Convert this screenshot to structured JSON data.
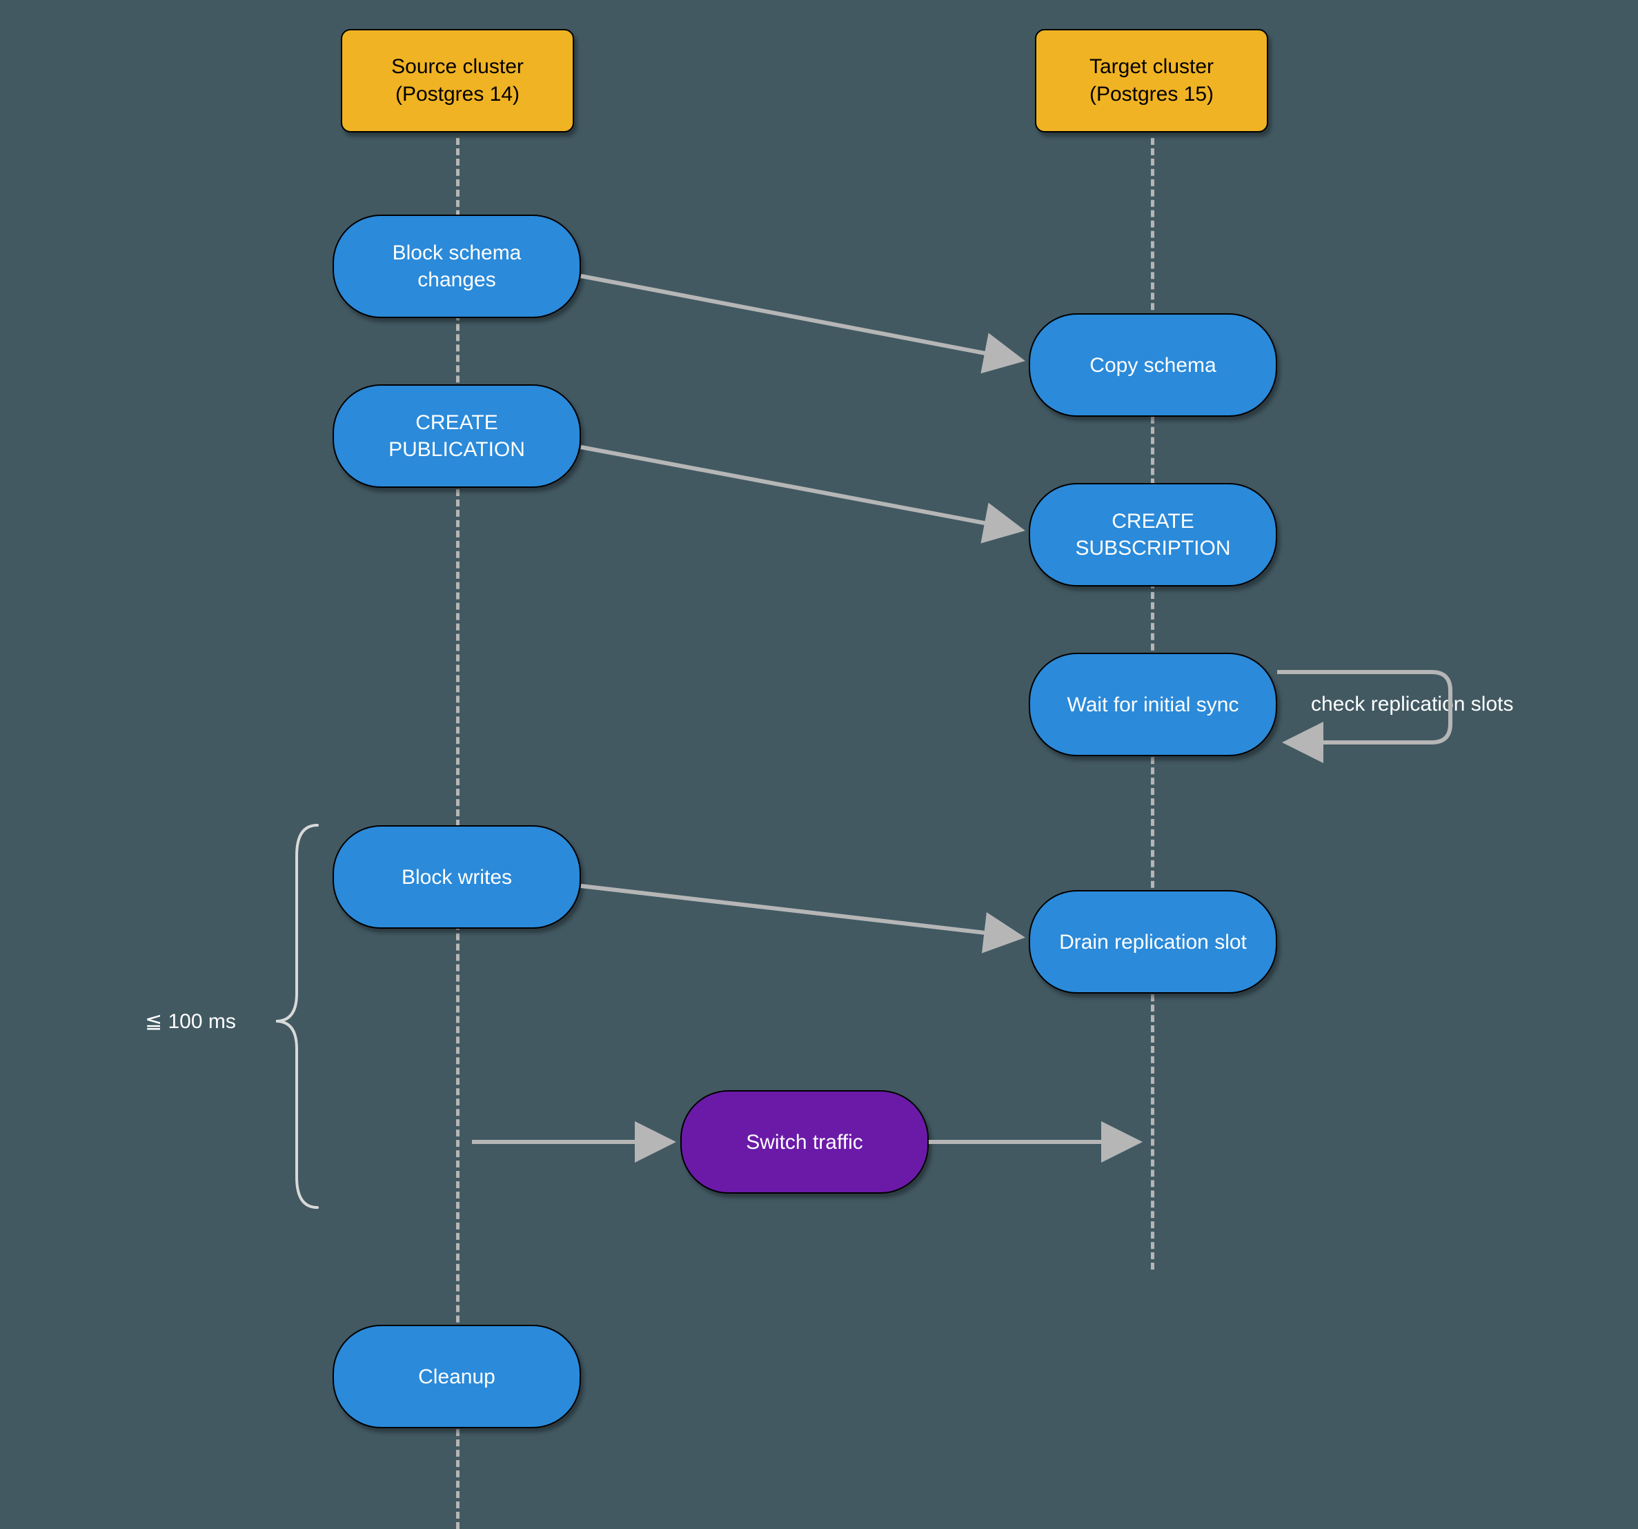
{
  "headers": {
    "source": {
      "line1": "Source cluster",
      "line2": "(Postgres 14)"
    },
    "target": {
      "line1": "Target cluster",
      "line2": "(Postgres 15)"
    }
  },
  "nodes": {
    "block_schema": {
      "line1": "Block schema",
      "line2": "changes"
    },
    "copy_schema": "Copy schema",
    "create_pub": {
      "line1": "CREATE",
      "line2": "PUBLICATION"
    },
    "create_sub": {
      "line1": "CREATE",
      "line2": "SUBSCRIPTION"
    },
    "wait_sync": "Wait for initial sync",
    "block_writes": "Block writes",
    "drain": "Drain replication slot",
    "switch": "Switch traffic",
    "cleanup": "Cleanup"
  },
  "labels": {
    "timing": "≦ 100 ms",
    "check_slots": "check replication slots"
  },
  "colors": {
    "bg": "#425962",
    "header_bg": "#f0b323",
    "blue": "#2b8ad9",
    "purple": "#6b1aa8",
    "line": "#b6b6b6"
  }
}
